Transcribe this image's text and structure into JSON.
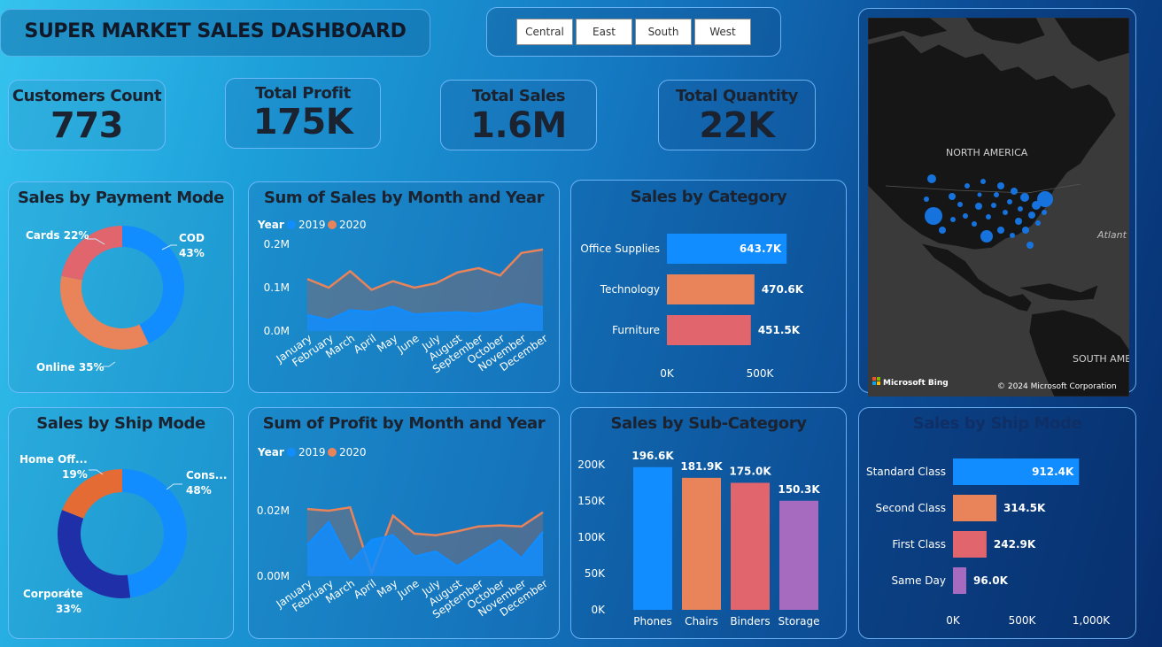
{
  "dashboard_title": "SUPER MARKET SALES DASHBOARD",
  "region_slicer": [
    "Central",
    "East",
    "South",
    "West"
  ],
  "kpis": [
    {
      "label": "Customers Count",
      "value": "773"
    },
    {
      "label": "Total Profit",
      "value": "175K"
    },
    {
      "label": "Total Sales",
      "value": "1.6M"
    },
    {
      "label": "Total Quantity",
      "value": "22K"
    }
  ],
  "colors": {
    "blue": "#118dff",
    "orange": "#e8835a",
    "red": "#e0656c",
    "purple": "#a66bbf",
    "navy": "#1f2fa8",
    "dark_orange": "#e56b35"
  },
  "map": {
    "label_na": "NORTH AMERICA",
    "label_sa": "SOUTH AME",
    "label_atl": "Atlant",
    "attribution": "Microsoft Bing",
    "copyright": "© 2024 Microsoft Corporation"
  },
  "months": [
    "January",
    "February",
    "March",
    "April",
    "May",
    "June",
    "July",
    "August",
    "September",
    "October",
    "November",
    "December"
  ],
  "chart_data": [
    {
      "type": "pie",
      "title": "Sales by Payment Mode",
      "slices": [
        {
          "name": "COD",
          "pct": 43,
          "label": "43%"
        },
        {
          "name": "Online",
          "pct": 35,
          "label": "35%"
        },
        {
          "name": "Cards",
          "pct": 22,
          "label": "22%"
        }
      ]
    },
    {
      "type": "area",
      "title": "Sum of Sales by Month and Year",
      "legend_title": "Year",
      "yticks": [
        "0.0M",
        "0.1M",
        "0.2M"
      ],
      "ylim": [
        0,
        200000
      ],
      "series": [
        {
          "name": "2019",
          "values": [
            37000,
            25000,
            48000,
            44000,
            56000,
            38000,
            41000,
            43000,
            40000,
            49000,
            63000,
            55000
          ]
        },
        {
          "name": "2020",
          "values": [
            120000,
            100000,
            138000,
            95000,
            115000,
            100000,
            110000,
            135000,
            145000,
            128000,
            180000,
            188000
          ]
        }
      ]
    },
    {
      "type": "bar",
      "title": "Sales by Category",
      "categories": [
        "Office Supplies",
        "Technology",
        "Furniture"
      ],
      "values": [
        643700,
        470600,
        451500
      ],
      "value_labels": [
        "643.7K",
        "470.6K",
        "451.5K"
      ],
      "xticks": [
        "0K",
        "500K"
      ]
    },
    {
      "type": "pie",
      "title": "Sales by Ship Mode",
      "slices": [
        {
          "name": "Cons...",
          "pct": 48,
          "label": "48%"
        },
        {
          "name": "Corporate",
          "pct": 33,
          "label": "33%"
        },
        {
          "name": "Home Off...",
          "pct": 19,
          "label": "19%"
        }
      ]
    },
    {
      "type": "area",
      "title": "Sum of Profit by Month and Year",
      "legend_title": "Year",
      "yticks": [
        "0.00M",
        "0.02M"
      ],
      "ylim": [
        0,
        0.03
      ],
      "series": [
        {
          "name": "2019",
          "values": [
            0.0095,
            0.0165,
            0.004,
            0.011,
            0.0125,
            0.006,
            0.0075,
            0.003,
            0.007,
            0.011,
            0.0055,
            0.0135
          ]
        },
        {
          "name": "2020",
          "values": [
            0.0205,
            0.02,
            0.021,
            0.001,
            0.0185,
            0.013,
            0.0125,
            0.0137,
            0.0152,
            0.0155,
            0.0152,
            0.0195
          ]
        }
      ]
    },
    {
      "type": "bar",
      "title": "Sales by Sub-Category",
      "categories": [
        "Phones",
        "Chairs",
        "Binders",
        "Storage"
      ],
      "values": [
        196600,
        181900,
        175000,
        150300
      ],
      "value_labels": [
        "196.6K",
        "181.9K",
        "175.0K",
        "150.3K"
      ],
      "yticks": [
        "0K",
        "50K",
        "100K",
        "150K",
        "200K"
      ]
    },
    {
      "type": "bar",
      "title": "Sales by Ship Mode",
      "categories": [
        "Standard Class",
        "Second Class",
        "First Class",
        "Same Day"
      ],
      "values": [
        912400,
        314500,
        242900,
        96000
      ],
      "value_labels": [
        "912.4K",
        "314.5K",
        "242.9K",
        "96.0K"
      ],
      "xticks": [
        "0K",
        "500K",
        "1,000K"
      ]
    }
  ]
}
